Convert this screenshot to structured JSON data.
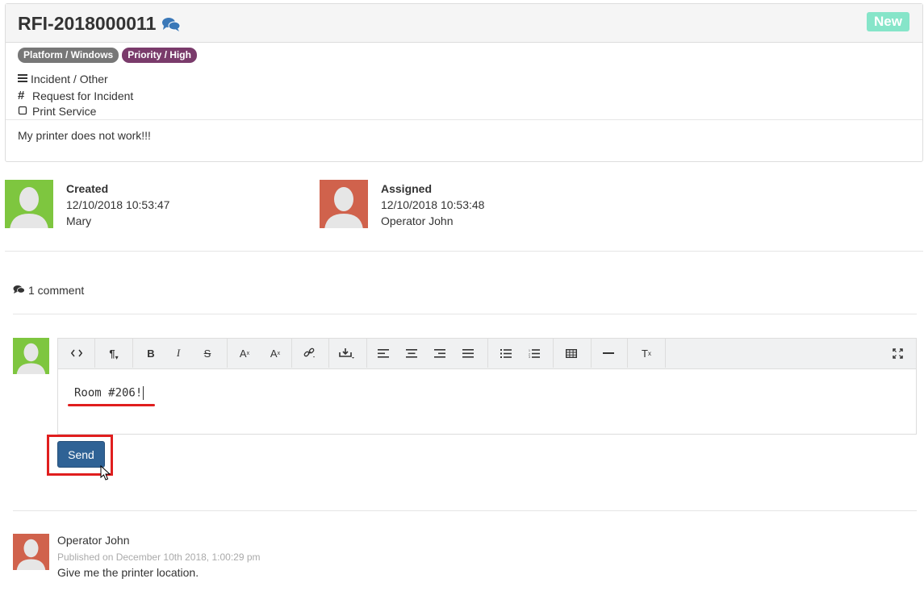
{
  "ticket": {
    "title": "RFI-2018000011",
    "title_icon": "comments-icon",
    "status": "New",
    "status_color": "#86e5c9",
    "tags": [
      {
        "label": "Platform / Windows",
        "color": "#777777"
      },
      {
        "label": "Priority / High",
        "color": "#7a3b6b"
      }
    ],
    "category": "Incident / Other",
    "type": "Request for Incident",
    "service": "Print Service",
    "description": "My printer does not work!!!"
  },
  "created": {
    "label": "Created",
    "datetime": "12/10/2018 10:53:47",
    "user": "Mary",
    "avatar_color": "#7ec63f"
  },
  "assigned": {
    "label": "Assigned",
    "datetime": "12/10/2018 10:53:48",
    "user": "Operator John",
    "avatar_color": "#d0624c"
  },
  "comments": {
    "count_label": "1 comment",
    "editor": {
      "text": "Room #206!",
      "toolbar": [
        "code-view-icon",
        "paragraph-icon",
        "bold-icon",
        "italic-icon",
        "strikethrough-icon",
        "superscript-icon",
        "subscript-icon",
        "link-icon",
        "insert-icon",
        "align-left-icon",
        "align-center-icon",
        "align-right-icon",
        "align-justify-icon",
        "unordered-list-icon",
        "ordered-list-icon",
        "table-icon",
        "horizontal-rule-icon",
        "clear-format-icon",
        "fullscreen-icon"
      ]
    },
    "send_label": "Send",
    "send_color": "#2f6295",
    "highlight_color": "#e01e1e",
    "items": [
      {
        "author": "Operator John",
        "published": "Published on December 10th 2018, 1:00:29 pm",
        "text": "Give me the printer location."
      }
    ]
  }
}
